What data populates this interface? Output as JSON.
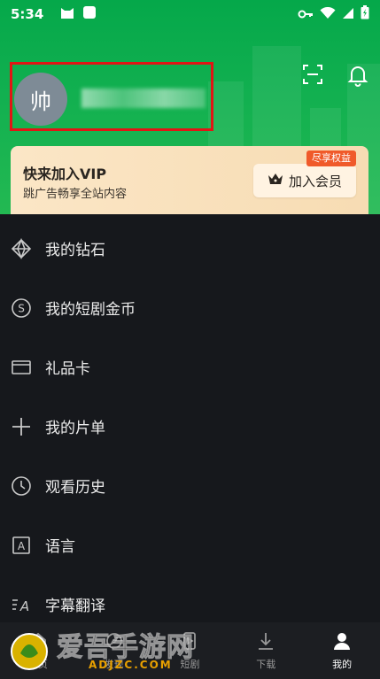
{
  "status_bar": {
    "time": "5:34"
  },
  "profile": {
    "avatar_char": "帅",
    "username": ""
  },
  "vip": {
    "title": "快来加入VIP",
    "subtitle": "跳广告畅享全站内容",
    "badge": "尽享权益",
    "button_label": "加入会员"
  },
  "menu": {
    "items": [
      {
        "label": "我的钻石",
        "icon": "diamond-icon"
      },
      {
        "label": "我的短剧金币",
        "icon": "coin-icon"
      },
      {
        "label": "礼品卡",
        "icon": "gift-card-icon"
      },
      {
        "label": "我的片单",
        "icon": "plus-icon"
      },
      {
        "label": "观看历史",
        "icon": "clock-icon"
      },
      {
        "label": "语言",
        "icon": "language-icon"
      },
      {
        "label": "字幕翻译",
        "icon": "translate-icon"
      }
    ]
  },
  "bottom_nav": {
    "items": [
      {
        "label": "首页",
        "icon": "home-icon"
      },
      {
        "label": "发现",
        "icon": "discover-icon"
      },
      {
        "label": "短剧",
        "icon": "short-drama-icon"
      },
      {
        "label": "下载",
        "icon": "download-icon"
      },
      {
        "label": "我的",
        "icon": "user-icon"
      }
    ]
  },
  "watermark": {
    "text": "爱吾手游网",
    "sub": "ADJZC.COM"
  },
  "colors": {
    "header_green": "#12b050",
    "vip_gold": "#f7dcb3",
    "badge_orange": "#f05a2a",
    "background": "#16181c"
  }
}
